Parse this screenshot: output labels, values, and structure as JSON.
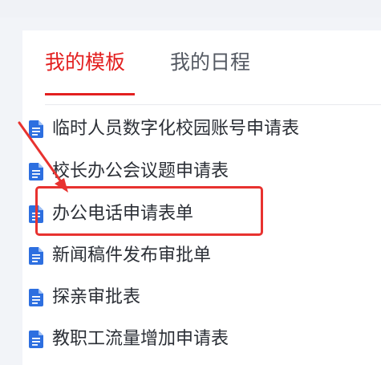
{
  "tabs": {
    "active_label": "我的模板",
    "inactive_label": "我的日程"
  },
  "templates": {
    "items": [
      {
        "label": "临时人员数字化校园账号申请表"
      },
      {
        "label": "校长办公会议题申请表"
      },
      {
        "label": "办公电话申请表单"
      },
      {
        "label": "新闻稿件发布审批单"
      },
      {
        "label": "探亲审批表"
      },
      {
        "label": "教职工流量增加申请表"
      }
    ]
  },
  "colors": {
    "accent": "#e32020",
    "icon": "#2d6fe0",
    "annotation": "#e8322f"
  },
  "icons": {
    "document": "document-icon"
  }
}
